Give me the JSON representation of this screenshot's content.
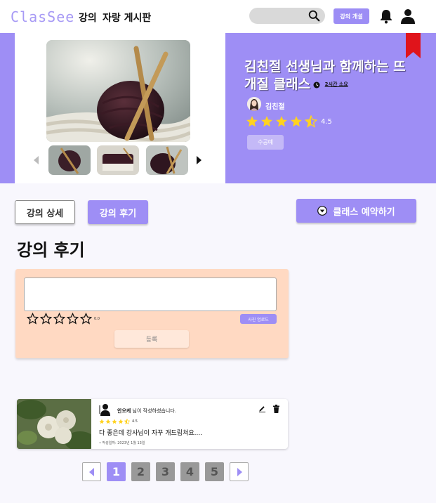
{
  "header": {
    "logo": "ClasSee",
    "nav": [
      "강의",
      "자랑 게시판"
    ],
    "open_class_button": "강의 개설"
  },
  "hero": {
    "title": "김친절 선생님과 함께하는 뜨개질 클래스",
    "duration": "2시간 소요",
    "teacher": "김친절",
    "rating": "4.5",
    "rating_value": 4.5,
    "status_button": "수공예"
  },
  "tabs": {
    "detail": "강의 상세",
    "review": "강의 후기"
  },
  "reserve_button": "클래스 예약하기",
  "section_title": "강의 후기",
  "review_form": {
    "score": "0.0",
    "photo_upload": "사진 업로드",
    "submit": "등록"
  },
  "reviews": [
    {
      "author": "안오케",
      "author_suffix": " 님이 작성하셨습니다.",
      "rating": "4.5",
      "rating_value": 4.5,
      "text": "다 좋은데 강사님이 자꾸 개드립쳐요....",
      "date": "작성일자: 2023년 1월 13일"
    }
  ],
  "pagination": {
    "pages": [
      "1",
      "2",
      "3",
      "4",
      "5"
    ],
    "current": "1"
  },
  "colors": {
    "accent": "#9e8ef5",
    "review_box": "#ffd9c2",
    "star": "#ffd21f"
  }
}
